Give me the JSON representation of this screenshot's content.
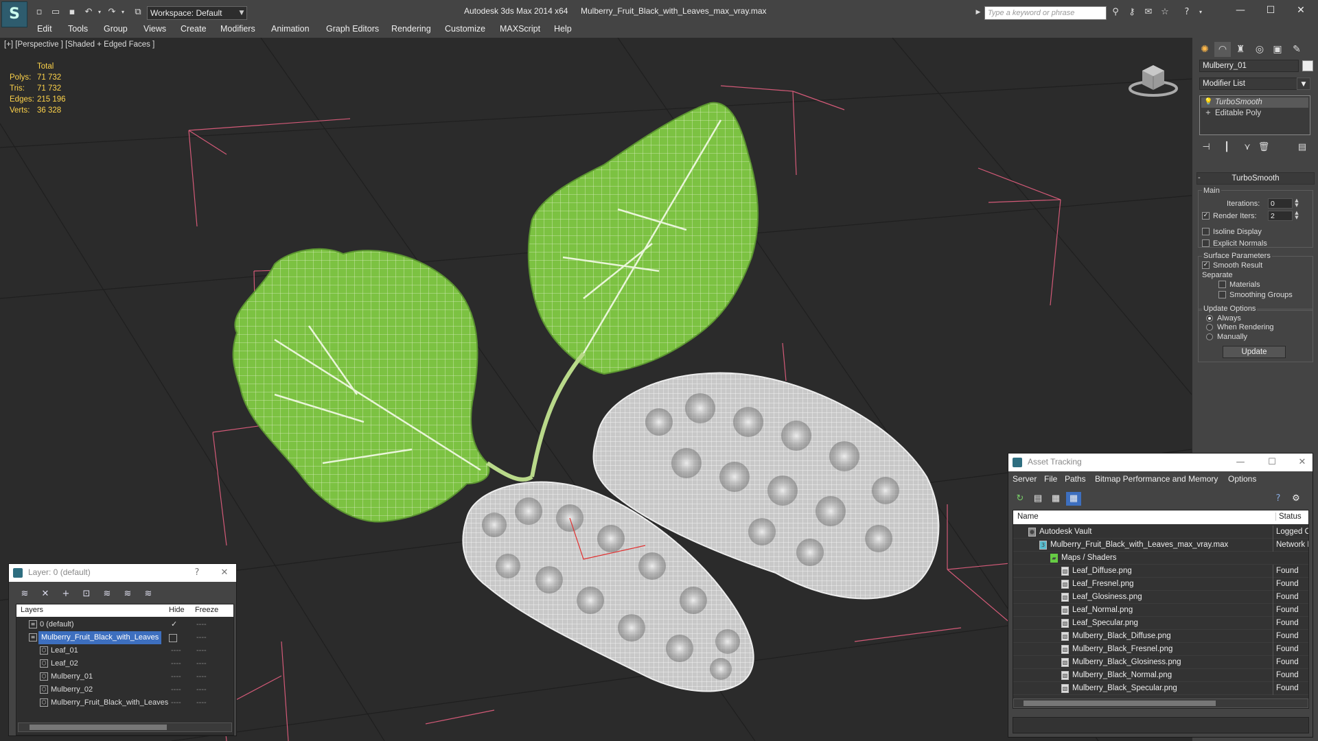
{
  "app": {
    "name": "Autodesk 3ds Max  2014 x64",
    "file": "Mulberry_Fruit_Black_with_Leaves_max_vray.max",
    "workspace": "Workspace: Default",
    "search_placeholder": "Type a keyword or phrase"
  },
  "menu": [
    "Edit",
    "Tools",
    "Group",
    "Views",
    "Create",
    "Modifiers",
    "Animation",
    "Graph Editors",
    "Rendering",
    "Customize",
    "MAXScript",
    "Help"
  ],
  "viewport": {
    "label": "[+] [Perspective ] [Shaded + Edged Faces ]",
    "stats": {
      "header": "Total",
      "rows": [
        {
          "label": "Polys:",
          "value": "71 732"
        },
        {
          "label": "Tris:",
          "value": "71 732"
        },
        {
          "label": "Edges:",
          "value": "215 196"
        },
        {
          "label": "Verts:",
          "value": "36 328"
        }
      ]
    }
  },
  "command_panel": {
    "object_name": "Mulberry_01",
    "modifier_list": "Modifier List",
    "stack": [
      "TurboSmooth",
      "Editable Poly"
    ],
    "rollout": {
      "title": "TurboSmooth",
      "main": "Main",
      "iterations_label": "Iterations:",
      "iterations": "0",
      "render_iters_label": "Render Iters:",
      "render_iters": "2",
      "isoline": "Isoline Display",
      "explicit": "Explicit Normals",
      "surface": "Surface Parameters",
      "smooth_result": "Smooth Result",
      "separate": "Separate",
      "materials": "Materials",
      "smoothing_groups": "Smoothing Groups",
      "update_options": "Update Options",
      "always": "Always",
      "when_rendering": "When Rendering",
      "manually": "Manually",
      "update_btn": "Update"
    }
  },
  "layer_dialog": {
    "title": "Layer: 0 (default)",
    "help": "?",
    "columns": {
      "layers": "Layers",
      "hide": "Hide",
      "freeze": "Freeze"
    },
    "rows": [
      {
        "name": "0 (default)",
        "indent": 1
      },
      {
        "name": "Mulberry_Fruit_Black_with_Leaves",
        "indent": 1
      },
      {
        "name": "Leaf_01",
        "indent": 2
      },
      {
        "name": "Leaf_02",
        "indent": 2
      },
      {
        "name": "Mulberry_01",
        "indent": 2
      },
      {
        "name": "Mulberry_02",
        "indent": 2
      },
      {
        "name": "Mulberry_Fruit_Black_with_Leaves",
        "indent": 2
      }
    ]
  },
  "asset_tracking": {
    "title": "Asset Tracking",
    "menu": [
      "Server",
      "File",
      "Paths",
      "Bitmap Performance and Memory",
      "Options"
    ],
    "columns": {
      "name": "Name",
      "status": "Status"
    },
    "rows": [
      {
        "name": "Autodesk Vault",
        "status": "Logged Ou",
        "indent": 1
      },
      {
        "name": "Mulberry_Fruit_Black_with_Leaves_max_vray.max",
        "status": "Network Pa",
        "indent": 2
      },
      {
        "name": "Maps / Shaders",
        "status": "",
        "indent": 3
      },
      {
        "name": "Leaf_Diffuse.png",
        "status": "Found",
        "indent": 4
      },
      {
        "name": "Leaf_Fresnel.png",
        "status": "Found",
        "indent": 4
      },
      {
        "name": "Leaf_Glosiness.png",
        "status": "Found",
        "indent": 4
      },
      {
        "name": "Leaf_Normal.png",
        "status": "Found",
        "indent": 4
      },
      {
        "name": "Leaf_Specular.png",
        "status": "Found",
        "indent": 4
      },
      {
        "name": "Mulberry_Black_Diffuse.png",
        "status": "Found",
        "indent": 4
      },
      {
        "name": "Mulberry_Black_Fresnel.png",
        "status": "Found",
        "indent": 4
      },
      {
        "name": "Mulberry_Black_Glosiness.png",
        "status": "Found",
        "indent": 4
      },
      {
        "name": "Mulberry_Black_Normal.png",
        "status": "Found",
        "indent": 4
      },
      {
        "name": "Mulberry_Black_Specular.png",
        "status": "Found",
        "indent": 4
      }
    ]
  },
  "colors": {
    "leaf": "#7cc242",
    "fruit": "#d8d8d8",
    "selection": "#3d6fbf",
    "stats": "#ffd44a"
  }
}
